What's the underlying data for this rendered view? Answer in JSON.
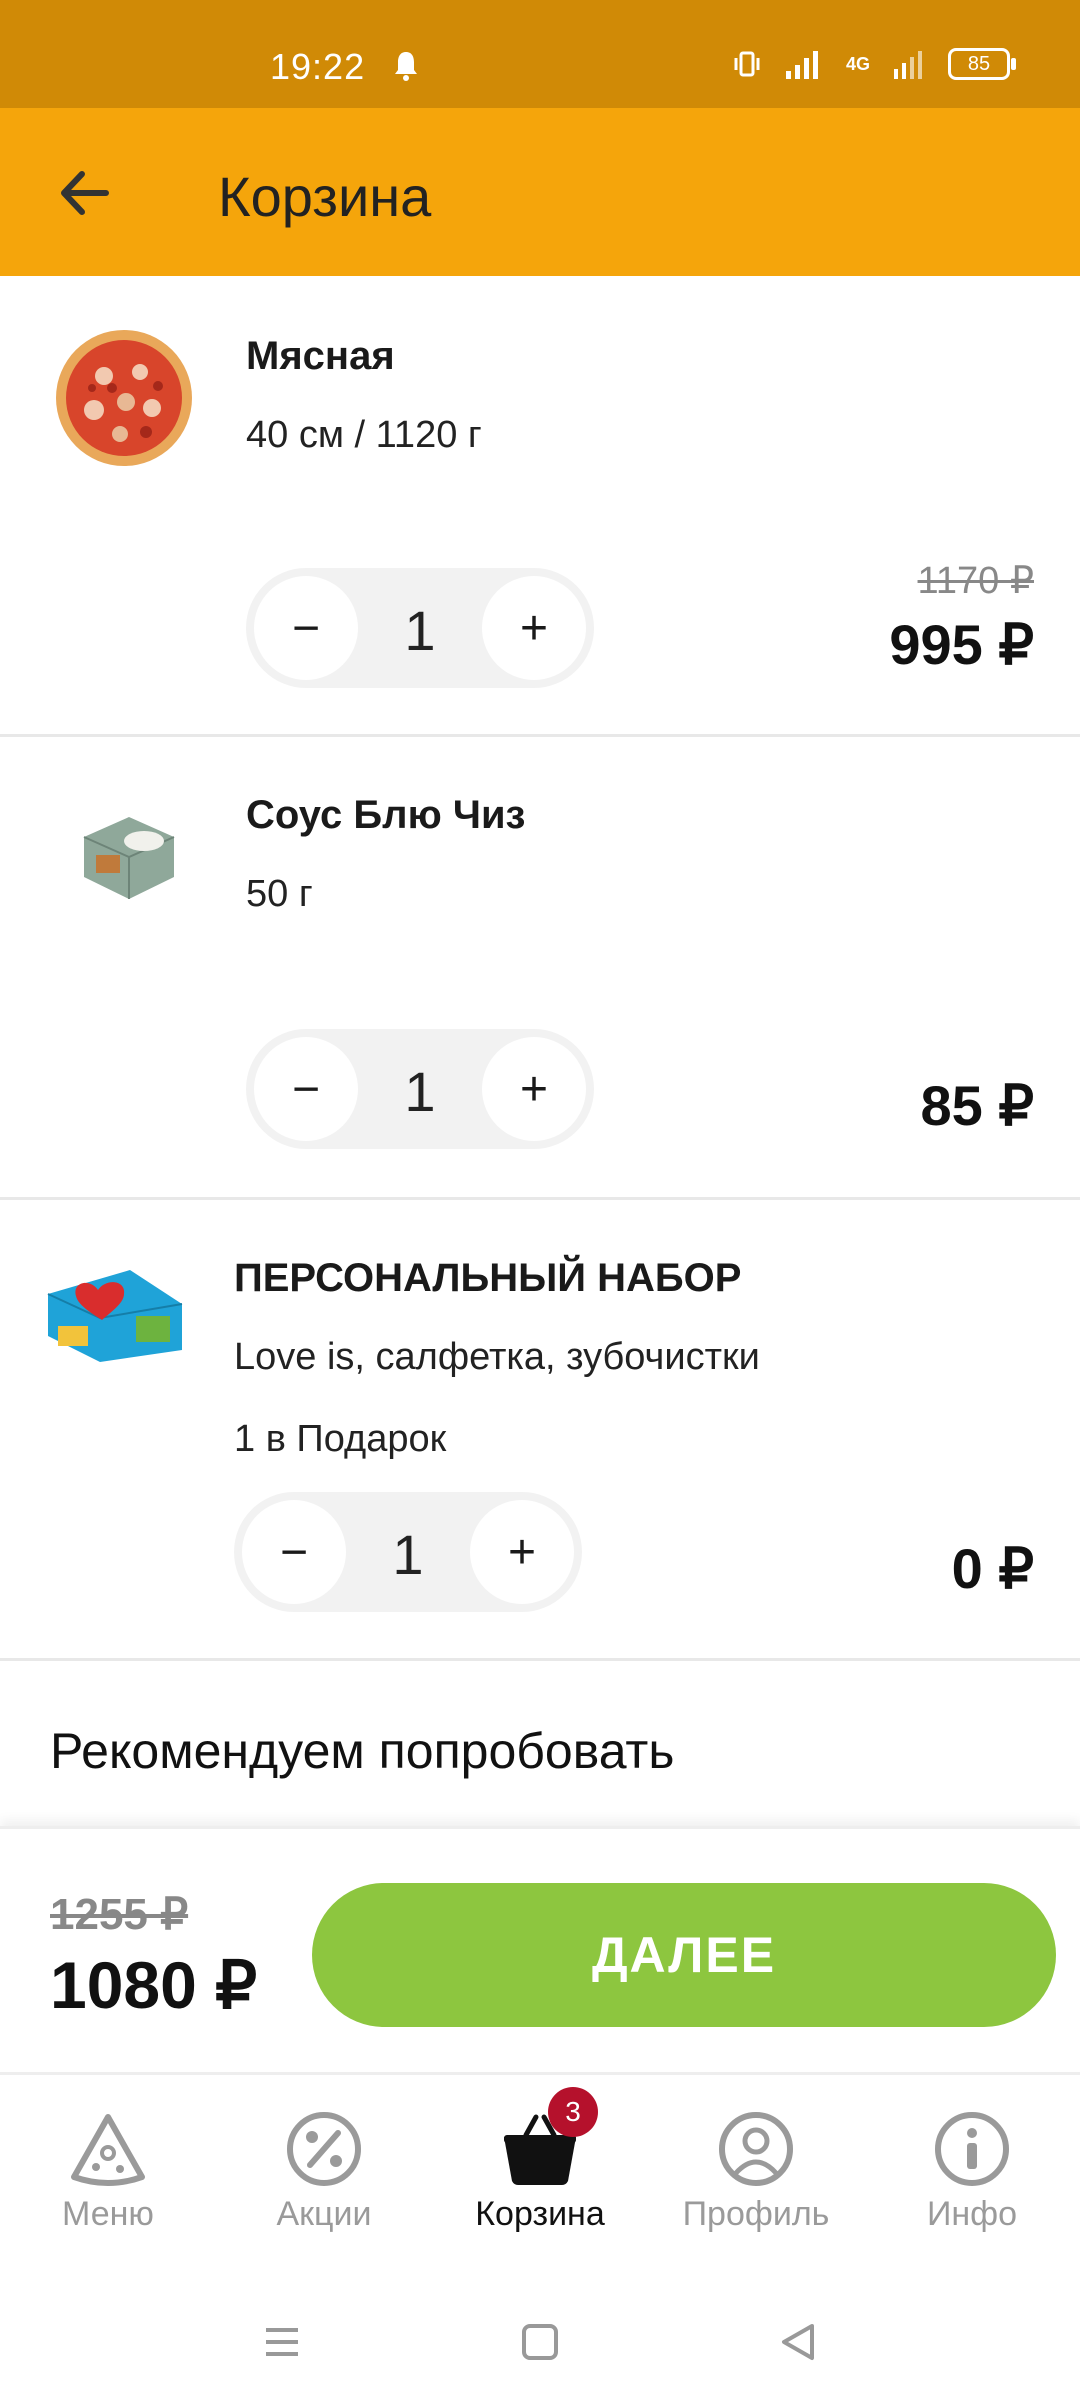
{
  "status_bar": {
    "time": "19:22",
    "network": "4G",
    "battery": "85"
  },
  "app_bar": {
    "title": "Корзина"
  },
  "items": [
    {
      "name": "Мясная",
      "description": "40 см / 1120 г",
      "quantity": "1",
      "old_price": "1170 ₽",
      "price": "995 ₽"
    },
    {
      "name": "Соус Блю Чиз",
      "description": "50 г",
      "quantity": "1",
      "price": "85 ₽"
    },
    {
      "name": "ПЕРСОНАЛЬНЫЙ НАБОР",
      "description": "Love is, салфетка, зубочистки",
      "note": "1 в Подарок",
      "quantity": "1",
      "price": "0 ₽"
    }
  ],
  "stepper": {
    "minus": "−",
    "plus": "+"
  },
  "recommend": {
    "title": "Рекомендуем попробовать"
  },
  "checkout": {
    "old_total": "1255 ₽",
    "total": "1080 ₽",
    "button": "ДАЛЕЕ"
  },
  "bottom_nav": {
    "items": [
      {
        "label": "Меню"
      },
      {
        "label": "Акции"
      },
      {
        "label": "Корзина",
        "badge": "3"
      },
      {
        "label": "Профиль"
      },
      {
        "label": "Инфо"
      }
    ]
  },
  "colors": {
    "status_bar": "#D08A06",
    "app_bar": "#F5A50B",
    "accent_button": "#8DC63F",
    "badge": "#B5112C"
  }
}
